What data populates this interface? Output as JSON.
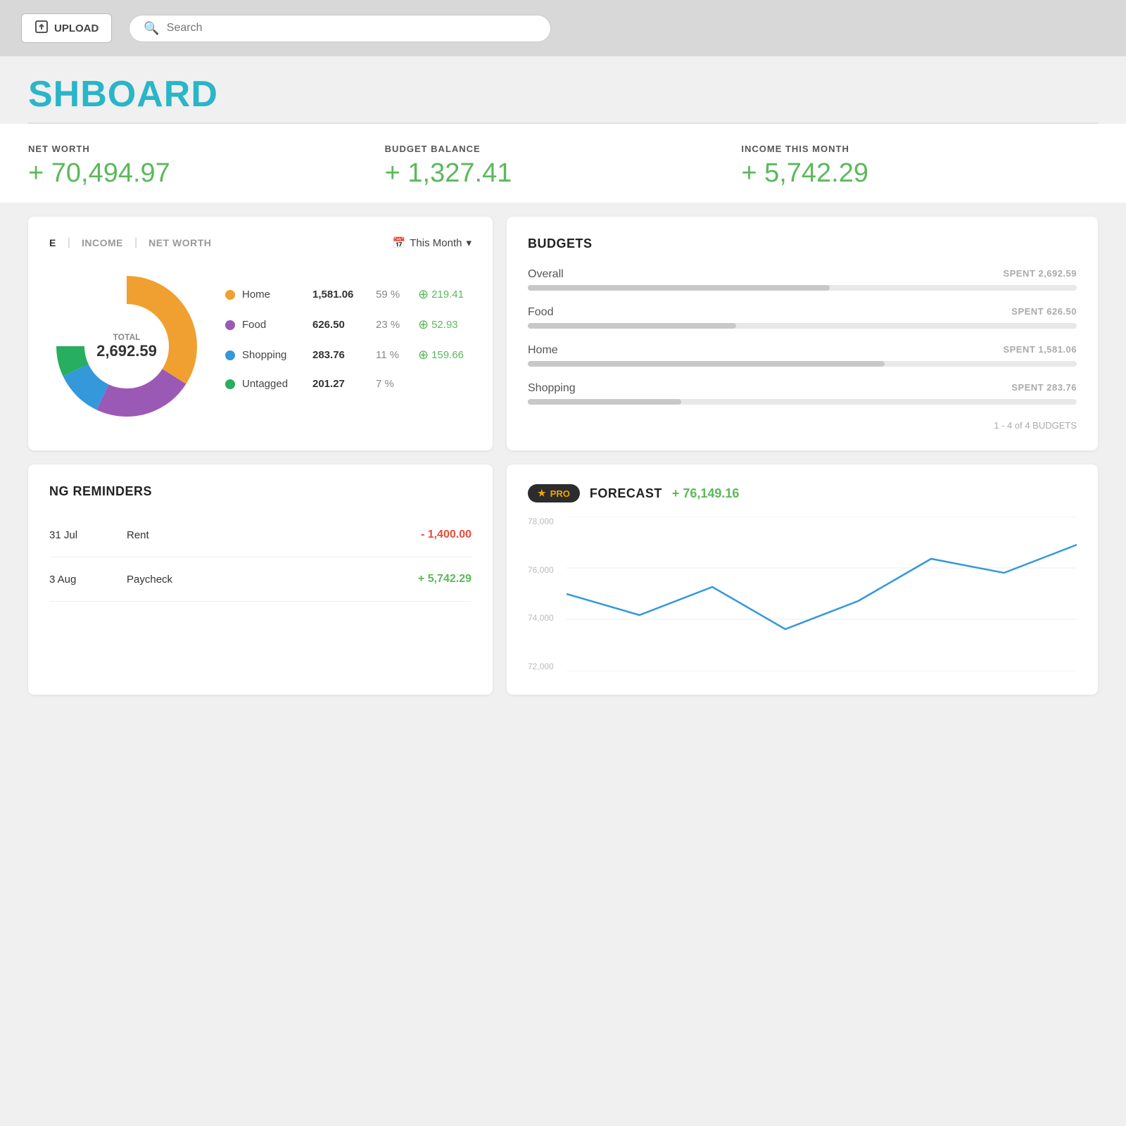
{
  "topbar": {
    "upload_label": "UPLOAD",
    "search_placeholder": "Search"
  },
  "page": {
    "title": "SHBOARD"
  },
  "stats": {
    "net_worth_label": "NET WORTH",
    "net_worth_value": "+ 70,494.97",
    "budget_balance_label": "BUDGET BALANCE",
    "budget_balance_value": "+ 1,327.41",
    "income_label": "INCOME THIS MONTH",
    "income_value": "+ 5,742.29"
  },
  "spending_panel": {
    "tabs": [
      "E",
      "INCOME",
      "NET WORTH"
    ],
    "period_label": "This Month",
    "total_label": "TOTAL",
    "total_value": "2,692.59",
    "categories": [
      {
        "name": "Home",
        "color": "#f0a030",
        "amount": "1,581.06",
        "pct": "59 %",
        "delta": "219.41"
      },
      {
        "name": "Food",
        "color": "#9b59b6",
        "amount": "626.50",
        "pct": "23 %",
        "delta": "52.93"
      },
      {
        "name": "Shopping",
        "color": "#3498db",
        "amount": "283.76",
        "pct": "11 %",
        "delta": "159.66"
      },
      {
        "name": "Untagged",
        "color": "#27ae60",
        "amount": "201.27",
        "pct": "7 %",
        "delta": ""
      }
    ]
  },
  "budgets_panel": {
    "title": "BUDGETS",
    "items": [
      {
        "name": "Overall",
        "spent_label": "SPENT 2,692.59",
        "fill_pct": 55,
        "color": "#aaaaaa"
      },
      {
        "name": "Food",
        "spent_label": "SPENT 626.50",
        "fill_pct": 38,
        "color": "#aaaaaa"
      },
      {
        "name": "Home",
        "spent_label": "SPENT 1,581.06",
        "fill_pct": 65,
        "color": "#aaaaaa"
      },
      {
        "name": "Shopping",
        "spent_label": "SPENT 283.76",
        "fill_pct": 28,
        "color": "#aaaaaa"
      }
    ],
    "pagination": "1 - 4 of 4 BUDGETS"
  },
  "reminders_panel": {
    "title": "NG REMINDERS",
    "items": [
      {
        "date": "31 Jul",
        "name": "Rent",
        "amount": "- 1,400.00",
        "type": "neg"
      },
      {
        "date": "3 Aug",
        "name": "Paycheck",
        "amount": "+ 5,742.29",
        "type": "pos"
      }
    ]
  },
  "forecast_panel": {
    "pro_label": "★ PRO",
    "title": "FORECAST",
    "value": "+ 76,149.16",
    "y_labels": [
      "78,000",
      "76,000",
      "74,000",
      "72,000"
    ]
  }
}
